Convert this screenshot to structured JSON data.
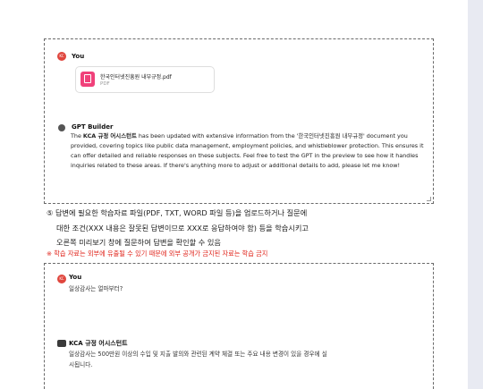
{
  "screenshot1": {
    "user": {
      "avatar_text": "KC",
      "name": "You",
      "file": {
        "name": "한국인터넷진흥원 내부규정.pdf",
        "type": "PDF",
        "icon": "pdf-file-icon"
      }
    },
    "assistant": {
      "name": "GPT Builder",
      "message": {
        "pre": "The ",
        "bold": "KCA 규정 어시스턴트",
        "post": " has been updated with extensive information from the '한국인터넷진흥원 내부규정' document you provided, covering topics like public data management, employment policies, and whistleblower protection. This ensures it can offer detailed and reliable responses on these subjects. Feel free to test the GPT in the preview to see how it handles inquiries related to these areas. If there's anything more to adjust or additional details to add, please let me know!"
      }
    }
  },
  "instruction": {
    "line1": "⑤ 답변에 필요한 학습자료 파일(PDF, TXT, WORD 파일 등)을 업로드하거나 질문에",
    "line2": "대한 조건(XXX 내용은 잘못된 답변이므로 XXX로 응답하여야 함) 등을 학습시키고",
    "line3": "오른쪽 미리보기 창에 질문하여 답변을 확인할 수 있음"
  },
  "warning": "※ 학습 자료는 외부에 유출될 수 있기 때문에 외부 공개가 금지된 자료는 학습 금지",
  "screenshot2": {
    "user": {
      "avatar_text": "KC",
      "name": "You",
      "question": "일상감사는 얼마부터?"
    },
    "assistant": {
      "name": "KCA 규정 어시스턴트",
      "answer_line1": "일상감사는 500만원 이상의 수입 및 지출 발의와 관련된 계약 체결 또는 주요 내용 변경이 있을 경우에 실",
      "answer_line2": "시됩니다."
    }
  },
  "colors": {
    "accent_red": "#e0241b",
    "avatar_red": "#e0463d",
    "pdf_pink": "#f0417a"
  }
}
